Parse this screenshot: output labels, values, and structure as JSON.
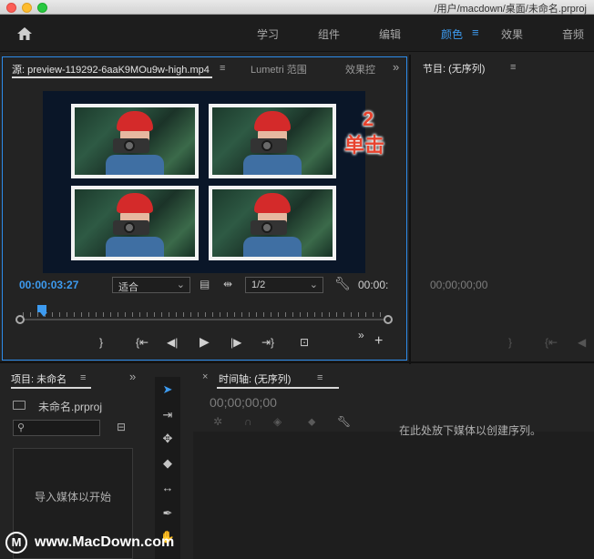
{
  "window": {
    "path": "/用户/macdown/桌面/未命名.prproj"
  },
  "workspaces": {
    "items": [
      "学习",
      "组件",
      "编辑",
      "颜色",
      "效果",
      "音频"
    ],
    "active": "颜色",
    "menu_icon": "hamburger-icon"
  },
  "source": {
    "tabs": [
      "源: preview-119292-6aaK9MOu9w-high.mp4",
      "Lumetri 范围",
      "效果控"
    ],
    "timecode": "00:00:03:27",
    "fit_value": "适合",
    "resolution_value": "1/2",
    "duration": "00:00:",
    "transport": [
      "mark-in",
      "mark-out",
      "go-to-in",
      "step-back",
      "play",
      "step-forward",
      "go-to-out",
      "export-frame"
    ],
    "add_icon": "+"
  },
  "annotation": {
    "number": "2",
    "text": "单击"
  },
  "program": {
    "title": "节目: (无序列)",
    "timecode": "00;00;00;00"
  },
  "project": {
    "title": "项目: 未命名",
    "file": "未命名.prproj",
    "search_placeholder": "",
    "empty_text": "导入媒体以开始"
  },
  "timeline": {
    "title": "时间轴: (无序列)",
    "timecode": "00;00;00;00",
    "empty_text": "在此处放下媒体以创建序列。"
  },
  "watermark": {
    "text": "www.MacDown.com",
    "logo": "M"
  },
  "colors": {
    "accent": "#3d9bf0",
    "annotation": "#e8432e",
    "panel": "#232323"
  }
}
